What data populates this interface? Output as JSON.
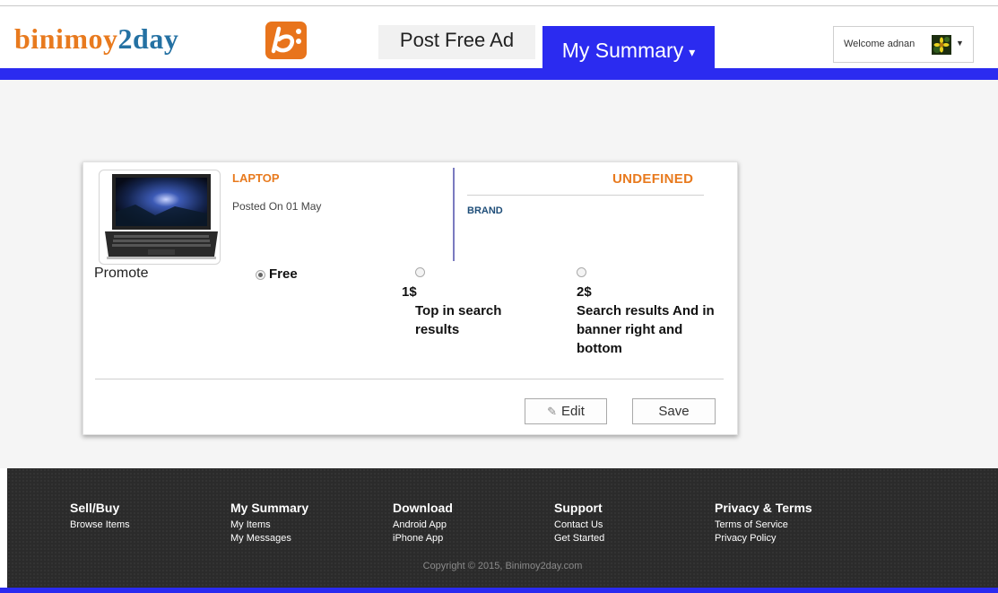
{
  "header": {
    "logo_main": "binimoy",
    "logo_accent": "2day",
    "nav_post_ad": "Post Free Ad",
    "nav_my_summary": "My Summary",
    "welcome": "Welcome adnan"
  },
  "colors": {
    "accent_orange": "#e87a1e",
    "nav_blue": "#2b2bf0",
    "brand_blue": "#1f4e79",
    "footer_bg": "#2b2b2b"
  },
  "ad": {
    "title": "LAPTOP",
    "posted": "Posted On 01 May",
    "status": "UNDEFINED",
    "brand_label": "BRAND",
    "promote_label": "Promote",
    "options": [
      {
        "price": "Free",
        "desc": "",
        "selected": true
      },
      {
        "price": "1$",
        "desc": "Top in search results",
        "selected": false
      },
      {
        "price": "2$",
        "desc": "Search results And in banner right and bottom",
        "selected": false
      }
    ],
    "edit_label": "Edit",
    "save_label": "Save"
  },
  "footer": {
    "columns": [
      {
        "heading": "Sell/Buy",
        "links": [
          "Browse Items"
        ]
      },
      {
        "heading": "My Summary",
        "links": [
          "My Items",
          "My Messages"
        ]
      },
      {
        "heading": "Download",
        "links": [
          "Android App",
          "iPhone App"
        ]
      },
      {
        "heading": "Support",
        "links": [
          "Contact Us",
          "Get Started"
        ]
      },
      {
        "heading": "Privacy & Terms",
        "links": [
          "Terms of Service",
          "Privacy Policy"
        ]
      }
    ],
    "copyright": "Copyright © 2015, Binimoy2day.com"
  }
}
